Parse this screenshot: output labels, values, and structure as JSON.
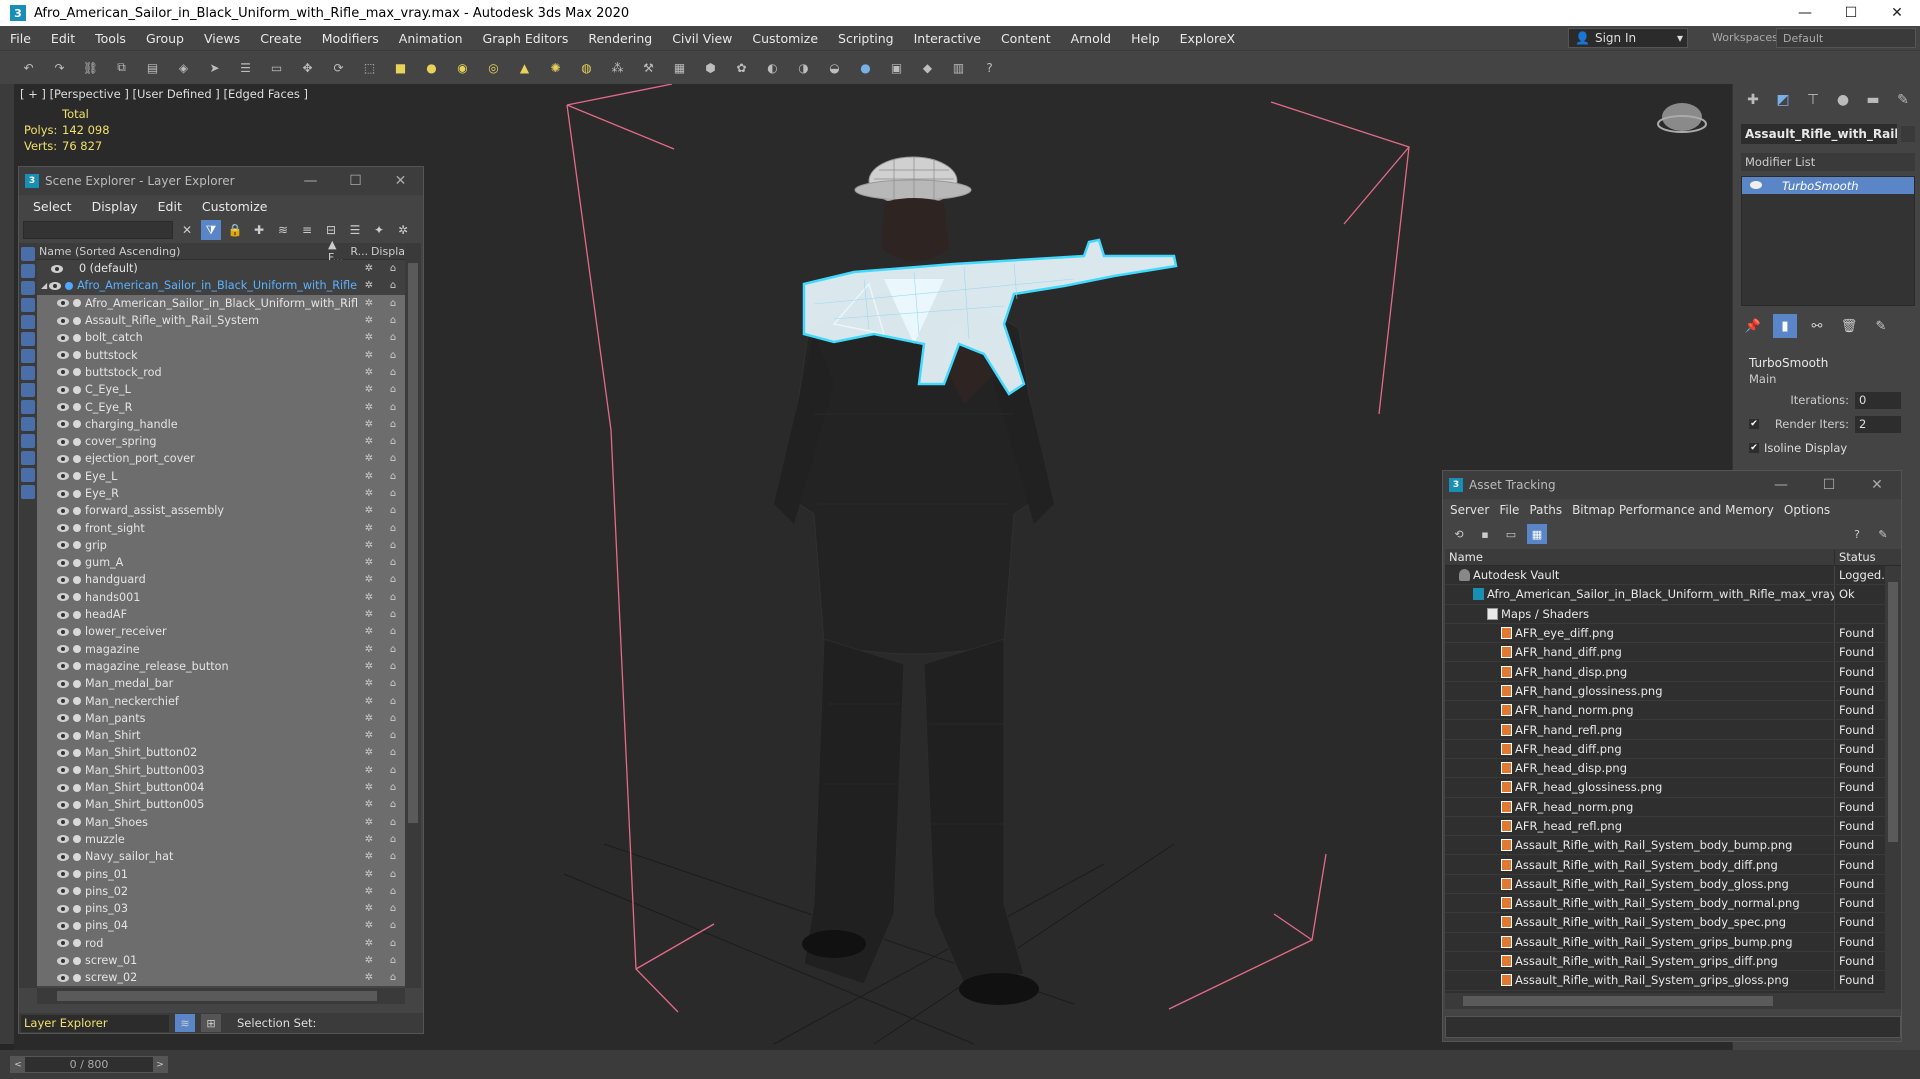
{
  "window": {
    "title": "Afro_American_Sailor_in_Black_Uniform_with_Rifle_max_vray.max - Autodesk 3ds Max 2020",
    "app_icon": "3",
    "minimize": "—",
    "maximize": "☐",
    "close": "✕"
  },
  "menu": [
    "File",
    "Edit",
    "Tools",
    "Group",
    "Views",
    "Create",
    "Modifiers",
    "Animation",
    "Graph Editors",
    "Rendering",
    "Civil View",
    "Customize",
    "Scripting",
    "Interactive",
    "Content",
    "Arnold",
    "Help",
    "ExploreX"
  ],
  "signin": {
    "label": "Sign In",
    "arrow": "▾"
  },
  "workspace": {
    "label": "Workspaces:",
    "value": "Default"
  },
  "viewport": {
    "label": "[ + ] [Perspective ] [User Defined ] [Edged Faces ]",
    "stats_header": "Total",
    "polys_label": "Polys:",
    "polys_value": "142 098",
    "verts_label": "Verts:",
    "verts_value": "76 827"
  },
  "scene_explorer": {
    "title": "Scene Explorer - Layer Explorer",
    "menu": [
      "Select",
      "Display",
      "Edit",
      "Customize"
    ],
    "col_name": "Name (Sorted Ascending)",
    "col_f": "▲ F...",
    "col_r": "R...",
    "col_disp": "Displa",
    "rows": [
      {
        "name": "0 (default)",
        "type": "def"
      },
      {
        "name": "Afro_American_Sailor_in_Black_Uniform_with_Rifle",
        "type": "grp"
      },
      {
        "name": "Afro_American_Sailor_in_Black_Uniform_with_Rifle",
        "type": "sel"
      },
      {
        "name": "Assault_Rifle_with_Rail_System",
        "type": "sel"
      },
      {
        "name": "bolt_catch",
        "type": "sel"
      },
      {
        "name": "buttstock",
        "type": "sel"
      },
      {
        "name": "buttstock_rod",
        "type": "sel"
      },
      {
        "name": "C_Eye_L",
        "type": "sel"
      },
      {
        "name": "C_Eye_R",
        "type": "sel"
      },
      {
        "name": "charging_handle",
        "type": "sel"
      },
      {
        "name": "cover_spring",
        "type": "sel"
      },
      {
        "name": "ejection_port_cover",
        "type": "sel"
      },
      {
        "name": "Eye_L",
        "type": "sel"
      },
      {
        "name": "Eye_R",
        "type": "sel"
      },
      {
        "name": "forward_assist_assembly",
        "type": "sel"
      },
      {
        "name": "front_sight",
        "type": "sel"
      },
      {
        "name": "grip",
        "type": "sel"
      },
      {
        "name": "gum_A",
        "type": "sel"
      },
      {
        "name": "handguard",
        "type": "sel"
      },
      {
        "name": "hands001",
        "type": "sel"
      },
      {
        "name": "headAF",
        "type": "sel"
      },
      {
        "name": "lower_receiver",
        "type": "sel"
      },
      {
        "name": "magazine",
        "type": "sel"
      },
      {
        "name": "magazine_release_button",
        "type": "sel"
      },
      {
        "name": "Man_medal_bar",
        "type": "sel"
      },
      {
        "name": "Man_neckerchief",
        "type": "sel"
      },
      {
        "name": "Man_pants",
        "type": "sel"
      },
      {
        "name": "Man_Shirt",
        "type": "sel"
      },
      {
        "name": "Man_Shirt_button02",
        "type": "sel"
      },
      {
        "name": "Man_Shirt_button003",
        "type": "sel"
      },
      {
        "name": "Man_Shirt_button004",
        "type": "sel"
      },
      {
        "name": "Man_Shirt_button005",
        "type": "sel"
      },
      {
        "name": "Man_Shoes",
        "type": "sel"
      },
      {
        "name": "muzzle",
        "type": "sel"
      },
      {
        "name": "Navy_sailor_hat",
        "type": "sel"
      },
      {
        "name": "pins_01",
        "type": "sel"
      },
      {
        "name": "pins_02",
        "type": "sel"
      },
      {
        "name": "pins_03",
        "type": "sel"
      },
      {
        "name": "pins_04",
        "type": "sel"
      },
      {
        "name": "rod",
        "type": "sel"
      },
      {
        "name": "screw_01",
        "type": "sel"
      },
      {
        "name": "screw_02",
        "type": "sel"
      }
    ],
    "footer_layer": "Layer Explorer",
    "footer_selset": "Selection Set:"
  },
  "command_panel": {
    "object_name": "Assault_Rifle_with_Rail_Sy",
    "modifier_list": "Modifier List",
    "modifier": "TurboSmooth",
    "rollout_title": "TurboSmooth",
    "rollout_sub": "Main",
    "iterations_label": "Iterations:",
    "iterations_value": "0",
    "render_iters_label": "Render Iters:",
    "render_iters_value": "2",
    "isoline_label": "Isoline Display",
    "check": "✔"
  },
  "asset_tracking": {
    "title": "Asset Tracking",
    "menu": [
      "Server",
      "File",
      "Paths",
      "Bitmap Performance and Memory",
      "Options"
    ],
    "col_name": "Name",
    "col_status": "Status",
    "rows": [
      {
        "name": "Autodesk Vault",
        "status": "Logged...",
        "indent": 14,
        "icon": "vault"
      },
      {
        "name": "Afro_American_Sailor_in_Black_Uniform_with_Rifle_max_vray.max",
        "status": "Ok",
        "indent": 28,
        "icon": "max"
      },
      {
        "name": "Maps / Shaders",
        "status": "",
        "indent": 42,
        "icon": "maps"
      },
      {
        "name": "AFR_eye_diff.png",
        "status": "Found",
        "indent": 56,
        "icon": "png"
      },
      {
        "name": "AFR_hand_diff.png",
        "status": "Found",
        "indent": 56,
        "icon": "png"
      },
      {
        "name": "AFR_hand_disp.png",
        "status": "Found",
        "indent": 56,
        "icon": "png"
      },
      {
        "name": "AFR_hand_glossiness.png",
        "status": "Found",
        "indent": 56,
        "icon": "png"
      },
      {
        "name": "AFR_hand_norm.png",
        "status": "Found",
        "indent": 56,
        "icon": "png"
      },
      {
        "name": "AFR_hand_refl.png",
        "status": "Found",
        "indent": 56,
        "icon": "png"
      },
      {
        "name": "AFR_head_diff.png",
        "status": "Found",
        "indent": 56,
        "icon": "png"
      },
      {
        "name": "AFR_head_disp.png",
        "status": "Found",
        "indent": 56,
        "icon": "png"
      },
      {
        "name": "AFR_head_glossiness.png",
        "status": "Found",
        "indent": 56,
        "icon": "png"
      },
      {
        "name": "AFR_head_norm.png",
        "status": "Found",
        "indent": 56,
        "icon": "png"
      },
      {
        "name": "AFR_head_refl.png",
        "status": "Found",
        "indent": 56,
        "icon": "png"
      },
      {
        "name": "Assault_Rifle_with_Rail_System_body_bump.png",
        "status": "Found",
        "indent": 56,
        "icon": "png"
      },
      {
        "name": "Assault_Rifle_with_Rail_System_body_diff.png",
        "status": "Found",
        "indent": 56,
        "icon": "png"
      },
      {
        "name": "Assault_Rifle_with_Rail_System_body_gloss.png",
        "status": "Found",
        "indent": 56,
        "icon": "png"
      },
      {
        "name": "Assault_Rifle_with_Rail_System_body_normal.png",
        "status": "Found",
        "indent": 56,
        "icon": "png"
      },
      {
        "name": "Assault_Rifle_with_Rail_System_body_spec.png",
        "status": "Found",
        "indent": 56,
        "icon": "png"
      },
      {
        "name": "Assault_Rifle_with_Rail_System_grips_bump.png",
        "status": "Found",
        "indent": 56,
        "icon": "png"
      },
      {
        "name": "Assault_Rifle_with_Rail_System_grips_diff.png",
        "status": "Found",
        "indent": 56,
        "icon": "png"
      },
      {
        "name": "Assault_Rifle_with_Rail_System_grips_gloss.png",
        "status": "Found",
        "indent": 56,
        "icon": "png"
      }
    ]
  },
  "timeline": {
    "frame": "0 / 800",
    "prev": "<",
    "next": ">"
  },
  "colors": {
    "selection_blue": "#5a86c8",
    "stats_yellow": "#f0e06a",
    "rifle_cyan": "#41d9ff",
    "bbox_pink": "#e36a88"
  }
}
